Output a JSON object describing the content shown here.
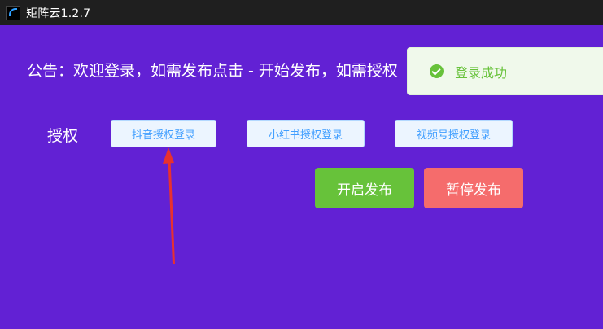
{
  "window": {
    "title": "矩阵云1.2.7"
  },
  "notice": {
    "text": "公告：欢迎登录，如需发布点击 - 开始发布，如需授权"
  },
  "toast": {
    "message": "登录成功"
  },
  "auth": {
    "label": "授权",
    "buttons": [
      "抖音授权登录",
      "小红书授权登录",
      "视频号授权登录"
    ]
  },
  "actions": {
    "start": "开启发布",
    "pause": "暂停发布"
  },
  "colors": {
    "background": "#6221d4",
    "success": "#67c23a",
    "danger": "#f56c6c",
    "primary": "#409eff",
    "annotation": "#e8312f"
  }
}
